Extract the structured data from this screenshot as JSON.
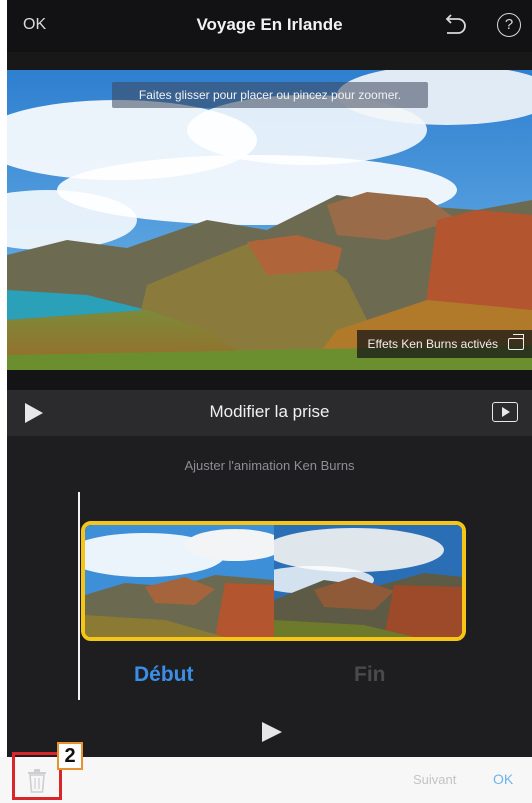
{
  "topbar": {
    "ok_label": "OK",
    "title": "Voyage En Irlande",
    "undo_icon": "undo-arrow-icon",
    "help_label": "?"
  },
  "viewer": {
    "hint": "Faites glisser pour placer ou pincez pour zoomer.",
    "ken_burns_badge": "Effets Ken Burns activés"
  },
  "editbar": {
    "title": "Modifier la prise"
  },
  "ken_burns": {
    "title": "Ajuster l'animation Ken Burns",
    "start_label": "Début",
    "end_label": "Fin"
  },
  "bottombar": {
    "next_label": "Suivant",
    "ok_label": "OK"
  },
  "annotation": {
    "step_number": "2"
  },
  "colors": {
    "accent_yellow": "#f5c518",
    "start_blue": "#3a8ee6",
    "ok_blue": "#6fb4ee",
    "callout_red": "#d9262b"
  }
}
